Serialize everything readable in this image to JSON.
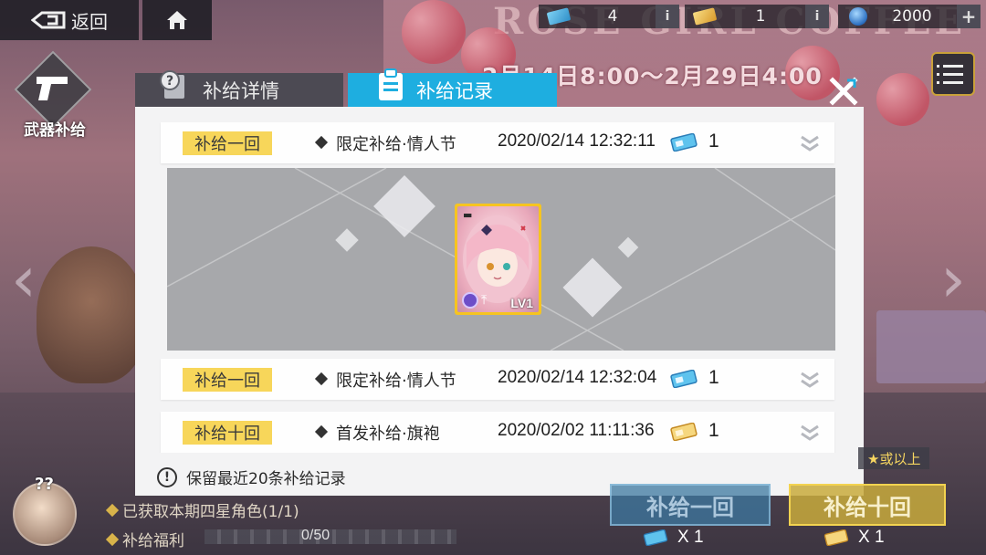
{
  "topbar": {
    "back_label": "返回",
    "resources": [
      {
        "name": "ticket-blue",
        "value": "4",
        "info": "i"
      },
      {
        "name": "ticket-gold",
        "value": "1",
        "info": "i"
      },
      {
        "name": "crystal",
        "value": "2000",
        "info": "+"
      }
    ]
  },
  "side": {
    "weapon_label": "武器补给"
  },
  "banner": {
    "date_range": "2月14日8:00～2月29日4:00"
  },
  "tabs": [
    {
      "label": "补给详情",
      "active": false
    },
    {
      "label": "补给记录",
      "active": true
    }
  ],
  "records": [
    {
      "badge": "补给一回",
      "type": "限定补给·情人节",
      "time": "2020/02/14 12:32:11",
      "ticket": "blue",
      "qty": "1",
      "expanded": true
    },
    {
      "badge": "补给一回",
      "type": "限定补给·情人节",
      "time": "2020/02/14 12:32:04",
      "ticket": "blue",
      "qty": "1",
      "expanded": false
    },
    {
      "badge": "补给十回",
      "type": "首发补给·旗袍",
      "time": "2020/02/02 11:11:36",
      "ticket": "gold",
      "qty": "1",
      "expanded": false
    }
  ],
  "expanded_card": {
    "level": "LV1"
  },
  "footer_note": "保留最近20条补给记录",
  "hud": {
    "line1": "已获取本期四星角色(1/1)",
    "line2": "补给福利",
    "progress_text": "0/50",
    "progress_fraction": 0,
    "pull_one": "补给一回",
    "pull_ten": "补给十回",
    "pull_ten_tag": "★或以上",
    "cost_one": "X 1",
    "cost_ten": "X 1"
  },
  "colors": {
    "accent_tab": "#1eaee0",
    "badge_yellow": "#f7d65a",
    "panel_bg": "#f3f3f4",
    "expanded_bg": "#a7a8ab",
    "card_frame": "#f6c420"
  }
}
